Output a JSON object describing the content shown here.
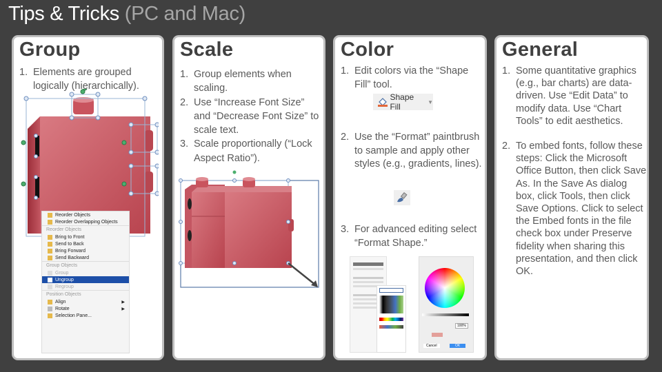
{
  "title": {
    "main": "Tips & Tricks",
    "sub": "(PC and Mac)"
  },
  "panels": {
    "group": {
      "heading": "Group",
      "items": [
        {
          "num": "1.",
          "text": "Elements are grouped logically (hierarchically)."
        }
      ],
      "context_menu": {
        "top_items": [
          "Reorder Objects",
          "Reorder Overlapping Objects"
        ],
        "sections": [
          {
            "header": "Reorder Objects",
            "items": [
              "Bring to Front",
              "Send to Back",
              "Bring Forward",
              "Send Backward"
            ]
          },
          {
            "header": "Group Objects",
            "items": [
              "Group",
              "Ungroup",
              "Regroup"
            ],
            "selected": "Ungroup",
            "disabled": [
              "Group",
              "Regroup"
            ]
          },
          {
            "header": "Position Objects",
            "items": [
              "Align",
              "Rotate",
              "Selection Pane..."
            ],
            "submenu": [
              "Align",
              "Rotate"
            ]
          }
        ]
      },
      "shape_color": "#c8525c"
    },
    "scale": {
      "heading": "Scale",
      "items": [
        {
          "num": "1.",
          "text": "Group elements when scaling."
        },
        {
          "num": "2.",
          "text": "Use “Increase Font Size” and “Decrease Font Size” to scale text."
        },
        {
          "num": "3.",
          "text": "Scale proportionally (“Lock Aspect Ratio”)."
        }
      ]
    },
    "color": {
      "heading": "Color",
      "items": [
        {
          "num": "1.",
          "text": "Edit colors via the “Shape Fill” tool."
        },
        {
          "num": "2.",
          "text": "Use the “Format” paintbrush to sample and apply other styles (e.g., gradients, lines)."
        },
        {
          "num": "3.",
          "text": "For advanced editing select “Format Shape.”"
        }
      ],
      "shape_fill_button": "Shape Fill",
      "color_picker": {
        "opacity_value": "100%",
        "cancel_label": "Cancel",
        "ok_label": "OK"
      }
    },
    "general": {
      "heading": "General",
      "items": [
        {
          "num": "1.",
          "text": "Some quantitative graphics (e.g., bar charts) are data-driven. Use “Edit Data” to modify data. Use “Chart Tools” to edit aesthetics."
        },
        {
          "num": "2.",
          "text": "To embed fonts, follow these steps: Click the Microsoft Office Button, then click Save As. In the Save As dialog box, click Tools, then click Save Options. Click to select the Embed fonts in the file check box under Preserve fidelity when sharing this presentation, and then click OK."
        }
      ]
    }
  },
  "colors": {
    "background": "#404040",
    "panel_border": "#bfbfbf",
    "heading": "#404040",
    "body_text": "#595959",
    "menu_selected": "#1d4fa8"
  }
}
